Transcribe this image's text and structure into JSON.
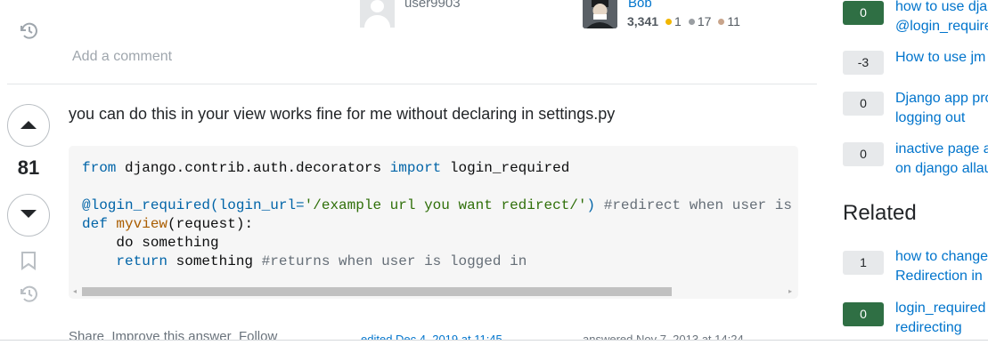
{
  "users": {
    "editor_name": "user9903",
    "author_name": "Bob",
    "author_rep": "3,341",
    "gold": "1",
    "silver": "17",
    "bronze": "11",
    "badge_colors": {
      "gold": "#f1b600",
      "silver": "#9a9ea2",
      "bronze": "#c8a48b"
    }
  },
  "question_comment": {
    "add_comment": "Add a comment"
  },
  "answer": {
    "score": "81",
    "text": "you can do this in your view works fine for me without declaring in settings.py",
    "code": {
      "line1_kw1": "from",
      "line1_mod": " django.contrib.auth.decorators ",
      "line1_kw2": "import",
      "line1_name": " login_required",
      "line3_dec": "@login_required(login_url=",
      "line3_str": "'/example url you want redirect/'",
      "line3_close": ")",
      "line3_comment": " #redirect when user is",
      "line4_kw": "def",
      "line4_fn": "myview",
      "line4_rest": "(request):",
      "line5": "    do something",
      "line6_kw": "return",
      "line6_rest": " something ",
      "line6_comment": "#returns when user is logged in"
    },
    "footer": {
      "share": "Share",
      "improve": "Improve this answer",
      "follow": "Follow",
      "edited": "edited Dec 4, 2019 at 11:45",
      "answered": "answered Nov 7, 2013 at 14:24"
    }
  },
  "sidebar": {
    "linked": [
      {
        "score": "0",
        "title": "how to use dja\n@login_require",
        "style": "pos"
      },
      {
        "score": "-3",
        "title": "How to use jm",
        "style": "neutral"
      },
      {
        "score": "0",
        "title": "Django app pro\nlogging out",
        "style": "neutral"
      },
      {
        "score": "0",
        "title": "inactive page a\non django allau",
        "style": "neutral"
      }
    ],
    "related_heading": "Related",
    "related": [
      {
        "score": "1",
        "title": "how to change\nRedirection in",
        "style": "neutral"
      },
      {
        "score": "0",
        "title": "login_required\nredirecting",
        "style": "pos"
      }
    ]
  }
}
